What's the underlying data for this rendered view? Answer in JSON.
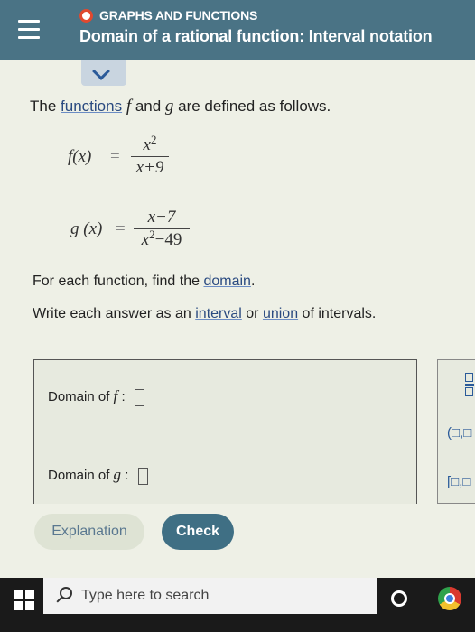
{
  "header": {
    "topic": "GRAPHS AND FUNCTIONS",
    "title": "Domain of a rational function: Interval notation"
  },
  "intro": {
    "prefix": "The ",
    "link": "functions",
    "f": "f",
    "and": " and ",
    "g": "g",
    "suffix": " are defined as follows."
  },
  "equations": {
    "f": {
      "name": "f",
      "arg": "x",
      "num_base": "x",
      "num_exp": "2",
      "den": "x+9"
    },
    "g": {
      "name": "g",
      "arg": "x",
      "num": "x−7",
      "den_base": "x",
      "den_exp": "2",
      "den_rest": "−49"
    }
  },
  "instructions": {
    "line1_prefix": "For each function, find the ",
    "line1_link": "domain",
    "line1_suffix": ".",
    "line2_prefix": "Write each answer as an ",
    "line2_link1": "interval",
    "line2_mid": " or ",
    "line2_link2": "union",
    "line2_suffix": " of intervals."
  },
  "answers": {
    "f_label": "Domain of ",
    "f_var": "f",
    "g_label": "Domain of ",
    "g_var": "g",
    "colon": " : ",
    "f_value": "",
    "g_value": ""
  },
  "palette": {
    "open_interval": "(□,□",
    "closed_interval": "[□,□"
  },
  "buttons": {
    "explanation": "Explanation",
    "check": "Check"
  },
  "taskbar": {
    "search_placeholder": "Type here to search"
  },
  "icons": [
    "menu-icon",
    "chevron-down-icon",
    "fraction-icon",
    "windows-start-icon",
    "search-icon",
    "cortana-icon",
    "chrome-icon"
  ],
  "colors": {
    "header": "#4a7385",
    "topic_dot": "#e0492f",
    "link": "#2a4a80",
    "check_button": "#3f6f84"
  }
}
